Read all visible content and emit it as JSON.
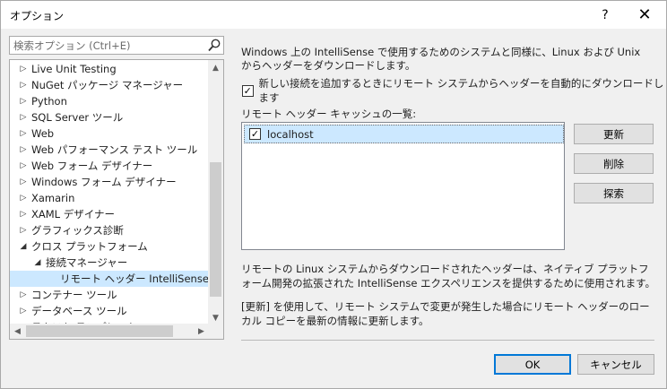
{
  "window": {
    "title": "オプション",
    "help_glyph": "?",
    "close_glyph": "✕"
  },
  "search": {
    "placeholder": "検索オプション (Ctrl+E)",
    "value": ""
  },
  "tree": {
    "items": [
      {
        "label": "Live Unit Testing",
        "level": 0,
        "state": "collapsed",
        "selected": false
      },
      {
        "label": "NuGet パッケージ マネージャー",
        "level": 0,
        "state": "collapsed",
        "selected": false
      },
      {
        "label": "Python",
        "level": 0,
        "state": "collapsed",
        "selected": false
      },
      {
        "label": "SQL Server ツール",
        "level": 0,
        "state": "collapsed",
        "selected": false
      },
      {
        "label": "Web",
        "level": 0,
        "state": "collapsed",
        "selected": false
      },
      {
        "label": "Web パフォーマンス テスト ツール",
        "level": 0,
        "state": "collapsed",
        "selected": false
      },
      {
        "label": "Web フォーム デザイナー",
        "level": 0,
        "state": "collapsed",
        "selected": false
      },
      {
        "label": "Windows フォーム デザイナー",
        "level": 0,
        "state": "collapsed",
        "selected": false
      },
      {
        "label": "Xamarin",
        "level": 0,
        "state": "collapsed",
        "selected": false
      },
      {
        "label": "XAML デザイナー",
        "level": 0,
        "state": "collapsed",
        "selected": false
      },
      {
        "label": "グラフィックス診断",
        "level": 0,
        "state": "collapsed",
        "selected": false
      },
      {
        "label": "クロス プラットフォーム",
        "level": 0,
        "state": "expanded",
        "selected": false
      },
      {
        "label": "接続マネージャー",
        "level": 1,
        "state": "expanded",
        "selected": false
      },
      {
        "label": "リモート ヘッダー IntelliSense マネ-",
        "level": 2,
        "state": "leaf",
        "selected": true
      },
      {
        "label": "コンテナー ツール",
        "level": 0,
        "state": "collapsed",
        "selected": false
      },
      {
        "label": "データベース ツール",
        "level": 0,
        "state": "collapsed",
        "selected": false
      },
      {
        "label": "テキスト テンプレート",
        "level": 0,
        "state": "collapsed",
        "selected": false
      }
    ],
    "glyphs": {
      "collapsed": "▷",
      "expanded": "◢",
      "up": "▲",
      "down": "▼",
      "left": "◀",
      "right": "▶"
    }
  },
  "panel": {
    "description": "Windows 上の IntelliSense で使用するためのシステムと同様に、Linux および Unix からヘッダーをダウンロードします。",
    "auto_download": {
      "label": "新しい接続を追加するときにリモート システムからヘッダーを自動的にダウンロードします",
      "checked": true,
      "glyph": "✓"
    },
    "cache_list_label": "リモート ヘッダー キャッシュの一覧:",
    "cache_items": [
      {
        "label": "localhost",
        "checked": true
      }
    ],
    "buttons": {
      "refresh": "更新",
      "delete": "削除",
      "explore": "探索"
    },
    "info1": "リモートの Linux システムからダウンロードされたヘッダーは、ネイティブ プラットフォーム開発の拡張された IntelliSense エクスペリエンスを提供するために使用されます。",
    "info2": "[更新] を使用して、リモート システムで変更が発生した場合にリモート ヘッダーのローカル コピーを最新の情報に更新します。"
  },
  "footer": {
    "ok": "OK",
    "cancel": "キャンセル"
  }
}
